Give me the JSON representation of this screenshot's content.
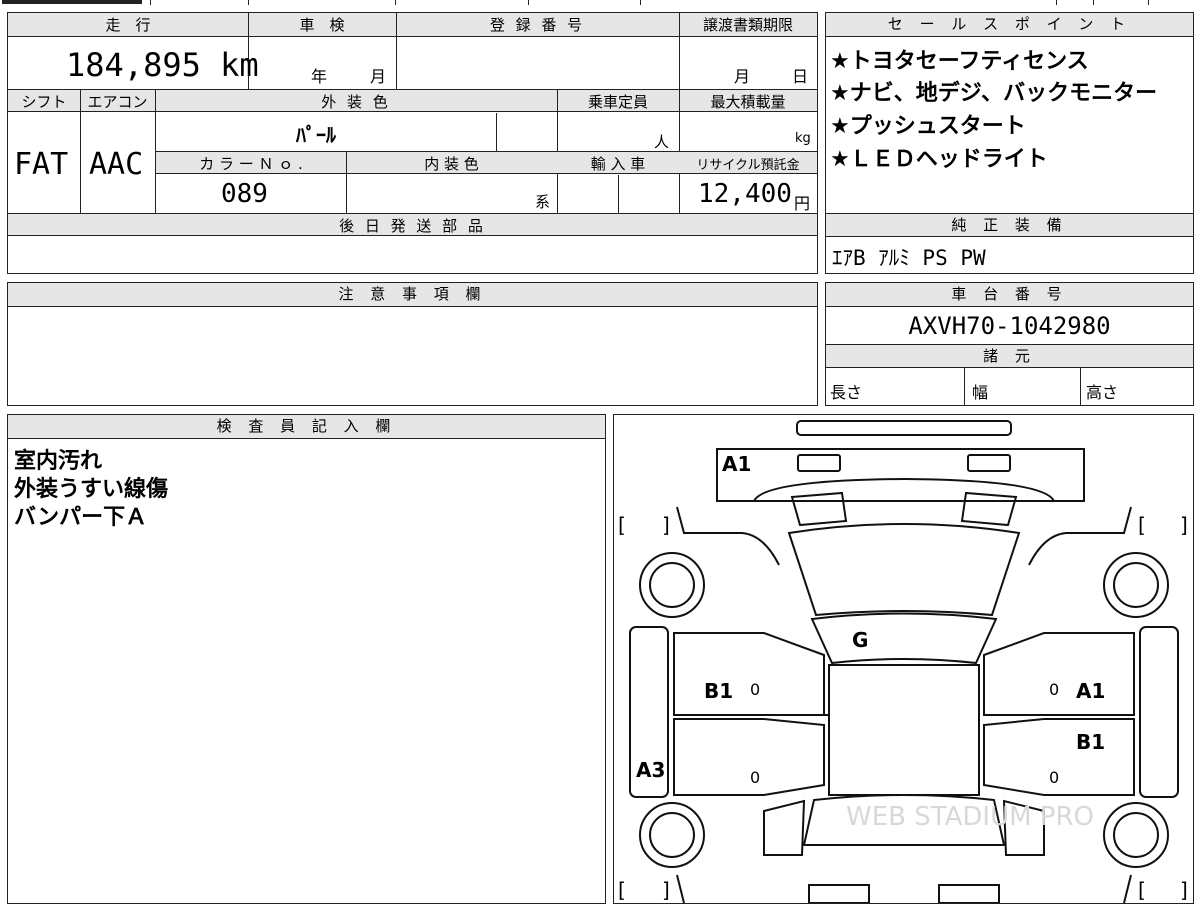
{
  "top_table": {
    "h_mileage": "走　行",
    "h_shaken": "車　検",
    "h_registration": "登 録 番 号",
    "h_transfer": "譲渡書類期限",
    "mileage": "184,895 km",
    "shaken_year": "年",
    "shaken_month": "月",
    "transfer_month": "月",
    "transfer_day": "日",
    "h_shift": "シフト",
    "h_aircon": "エアコン",
    "h_exterior_color": "外 装 色",
    "h_capacity": "乗車定員",
    "h_max_load": "最大積載量",
    "shift": "FAT",
    "aircon": "AAC",
    "exterior_color": "ﾊﾟｰﾙ",
    "capacity_unit": "人",
    "load_unit": "kg",
    "h_color_no": "カ ラ ー Ｎ ｏ .",
    "h_interior_color": "内 装 色",
    "h_import": "輸 入 車",
    "h_recycle": "リサイクル預託金",
    "color_no": "089",
    "interior_suffix": "系",
    "recycle_fee": "12,400",
    "recycle_unit": "円",
    "h_parts_later": "後 日 発 送 部 品"
  },
  "sales_points": {
    "header": "セ ー ル ス ポ イ ン ト",
    "items": [
      "★トヨタセーフティセンス",
      "★ナビ、地デジ、バックモニター",
      "★プッシュスタート",
      "★ＬＥＤヘッドライト"
    ]
  },
  "equipment": {
    "header": "純 正 装 備",
    "value": "ｴｱB ｱﾙﾐ PS PW"
  },
  "notes": {
    "header": "注 意 事 項 欄"
  },
  "chassis": {
    "header": "車 台 番 号",
    "value": "AXVH70-1042980"
  },
  "specs": {
    "header": "諸 元",
    "length": "長さ",
    "width": "幅",
    "height": "高さ"
  },
  "inspector": {
    "header": "検 査 員 記 入 欄",
    "lines": [
      "室内汚れ",
      "外装うすい線傷",
      "バンパー下Ａ"
    ]
  },
  "diagram": {
    "marks": {
      "front": "A1",
      "windshield": "G",
      "left_front_door": "B1",
      "right_front_door": "A1",
      "right_rear_door": "B1",
      "left_rocker": "A3"
    },
    "zero": "0",
    "bracket_open": "[",
    "bracket_close": "]",
    "watermark": "WEB STADIUM PRO"
  }
}
